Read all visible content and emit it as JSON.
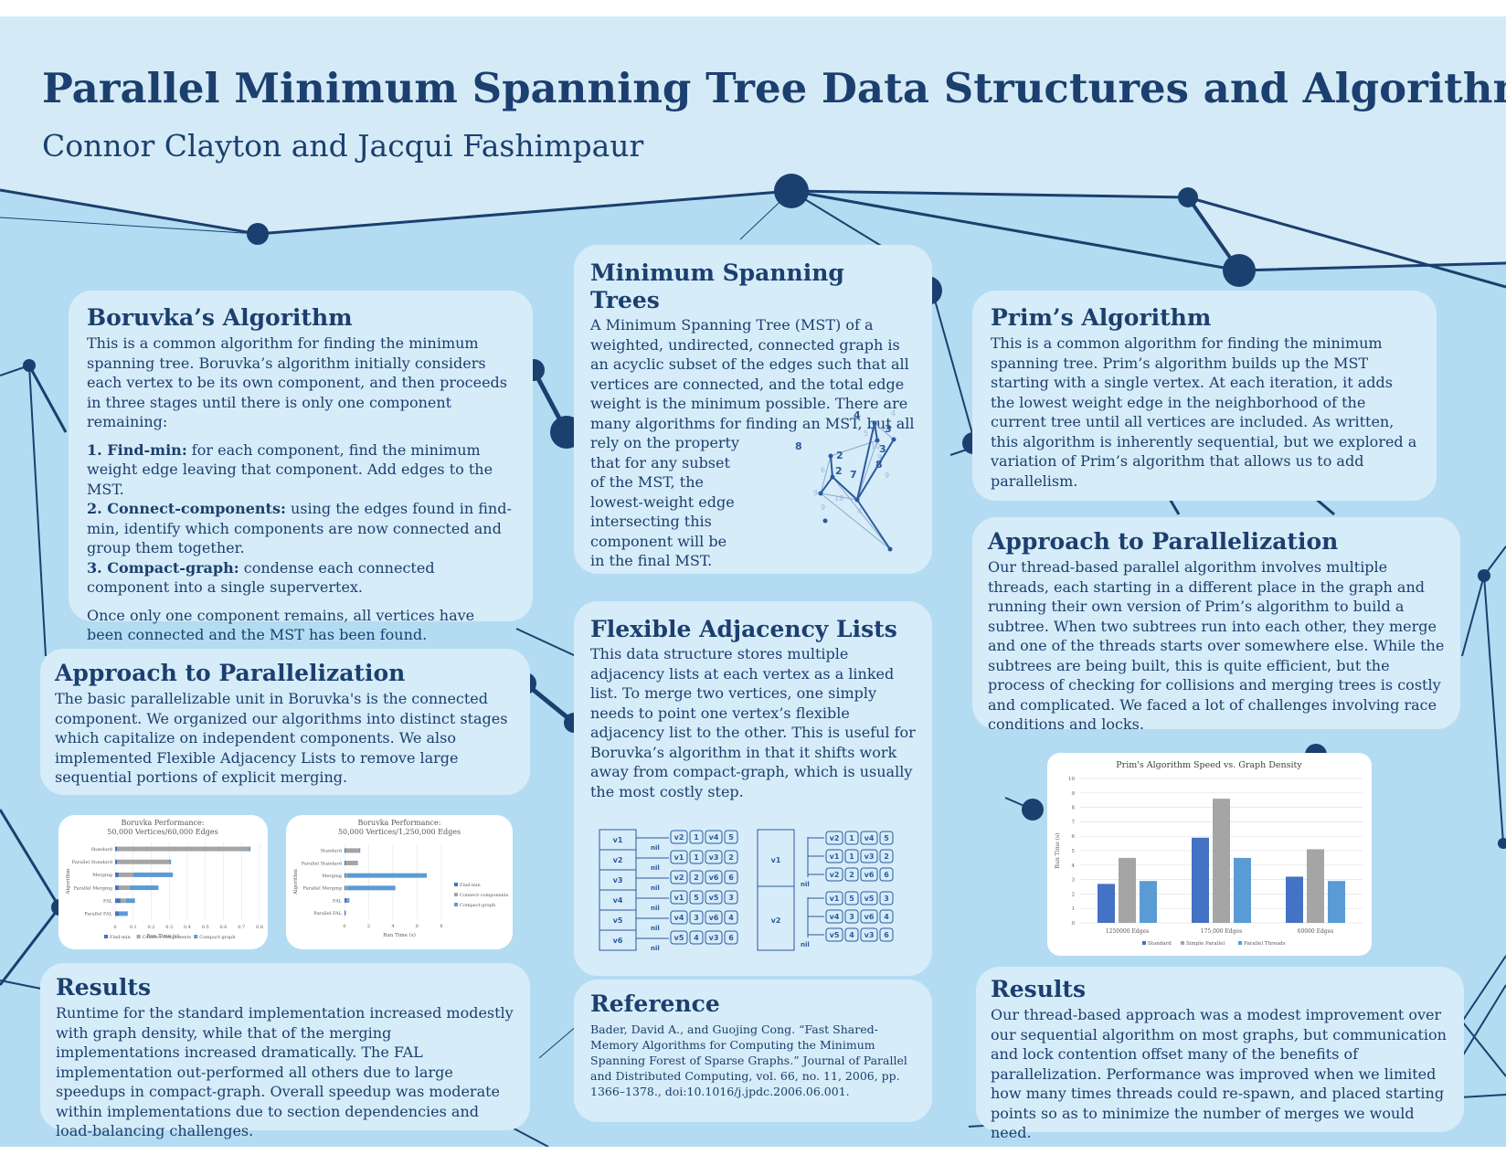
{
  "title": "Parallel Minimum Spanning Tree Data Structures and Algorithms",
  "authors": "Connor Clayton and Jacqui Fashimpaur",
  "boruvka": {
    "heading": "Boruvka’s Algorithm",
    "intro": "This is a common algorithm for finding the minimum spanning tree. Boruvka’s algorithm initially considers each vertex to be its own component, and then proceeds in three stages until there is only one component remaining:",
    "step1_label": "1. Find-min:",
    "step1_text": " for each component, find the minimum weight edge leaving that component. Add edges to the MST.",
    "step2_label": "2. Connect-components:",
    "step2_text": " using the edges found in find-min, identify which components are now connected and group them together.",
    "step3_label": "3. Compact-graph:",
    "step3_text": " condense each connected component into a single supervertex.",
    "outro": "Once only one component remains, all vertices have been connected and the MST has been found."
  },
  "boruvka_parallel": {
    "heading": "Approach to Parallelization",
    "text": "The basic parallelizable unit in Boruvka's is the connected component. We organized our algorithms into distinct stages which capitalize on independent components. We also implemented Flexible Adjacency Lists to remove large sequential portions of explicit merging."
  },
  "boruvka_results": {
    "heading": "Results",
    "text": "Runtime for the standard implementation increased modestly with graph density, while that of the merging implementations increased dramatically. The FAL implementation out-performed all others due to large speedups in compact-graph. Overall speedup was moderate within implementations due to section dependencies and load-balancing challenges."
  },
  "mst": {
    "heading": "Minimum Spanning Trees",
    "text_wide": "A Minimum Spanning Tree (MST) of a weighted, undirected, connected graph is an acyclic subset of the edges such that all vertices are connected, and the total edge weight is the minimum possible. There are many algorithms for finding an MST, but all",
    "text_narrow": "rely on the property that for any subset of the MST, the lowest-weight edge intersecting this component will be in the final MST."
  },
  "fal": {
    "heading": "Flexible Adjacency Lists",
    "text": "This data structure stores multiple adjacency lists at each vertex as a linked list. To merge two vertices, one simply needs to point one vertex’s flexible adjacency list to the other. This is useful for Boruvka’s algorithm in that it shifts work away from compact-graph, which is usually the most costly step."
  },
  "reference": {
    "heading": "Reference",
    "text": "Bader, David A., and Guojing Cong. “Fast Shared-Memory Algorithms for Computing the Minimum Spanning Forest of Sparse Graphs.” Journal of Parallel and Distributed Computing, vol. 66, no. 11, 2006, pp. 1366–1378., doi:10.1016/j.jpdc.2006.06.001."
  },
  "prim": {
    "heading": "Prim’s Algorithm",
    "text": "This is a common algorithm for finding the minimum spanning tree. Prim’s algorithm builds up the MST starting with a single vertex. At each iteration, it adds the lowest weight edge in the neighborhood of the current tree until all vertices are included. As written, this algorithm is inherently sequential, but we explored a variation of Prim’s algorithm that allows us to add parallelism."
  },
  "prim_parallel": {
    "heading": "Approach to Parallelization",
    "text": "Our thread-based parallel algorithm involves multiple threads, each starting in a different place in the graph and running their own version of Prim’s algorithm to build a subtree. When two subtrees run into each other, they merge and one of the threads starts over somewhere else. While the subtrees are being built, this is quite efficient, but the process of checking for collisions and merging trees is costly and complicated. We faced a lot of challenges involving race conditions and locks."
  },
  "prim_results": {
    "heading": "Results",
    "text": "Our thread-based approach was a modest improvement over our sequential algorithm on most graphs, but communication and lock contention offset many of the benefits of parallelization. Performance was improved when we limited how many times threads could re-spawn, and placed starting points so as to minimize the number of merges we would need."
  },
  "mst_graph": {
    "weights": [
      "4",
      "4",
      "3",
      "5",
      "2",
      "6",
      "2",
      "8",
      "7",
      "9",
      "10",
      "3",
      "9",
      "9",
      "8",
      "18",
      "9",
      "4"
    ]
  },
  "fal_diagram": {
    "left_vertices": [
      "v1",
      "v2",
      "v3",
      "v4",
      "v5",
      "v6"
    ],
    "right_vertices": [
      "v1",
      "v2"
    ],
    "nil": "nil",
    "lists": [
      [
        "v2",
        "1",
        "v4",
        "5"
      ],
      [
        "v1",
        "1",
        "v3",
        "2"
      ],
      [
        "v2",
        "2",
        "v6",
        "6"
      ],
      [
        "v1",
        "5",
        "v5",
        "3"
      ],
      [
        "v4",
        "3",
        "v6",
        "4"
      ],
      [
        "v5",
        "4",
        "v3",
        "6"
      ]
    ]
  },
  "chart_data": [
    {
      "type": "bar",
      "orientation": "horizontal",
      "stacked": true,
      "title": "Boruvka Performance:",
      "subtitle": "50,000 Vertices/60,000 Edges",
      "categories": [
        "Standard",
        "Parallel Standard",
        "Merging",
        "Parallel Merging",
        "FAL",
        "Parallel FAL"
      ],
      "series": [
        {
          "name": "Find-min",
          "values": [
            0.01,
            0.01,
            0.02,
            0.02,
            0.03,
            0.02
          ]
        },
        {
          "name": "Connect-components",
          "values": [
            0.73,
            0.29,
            0.08,
            0.06,
            0.03,
            0.0
          ]
        },
        {
          "name": "Compact-graph",
          "values": [
            0.01,
            0.01,
            0.22,
            0.16,
            0.05,
            0.05
          ]
        }
      ],
      "xlabel": "Run Time (s)",
      "ylabel": "Algorithm",
      "xticks": [
        "0",
        "0.1",
        "0.2",
        "0.3",
        "0.4",
        "0.5",
        "0.6",
        "0.7",
        "0.8"
      ],
      "xlim": [
        0,
        0.8
      ],
      "legend": "bottom",
      "colors": {
        "Find-min": "#4472c4",
        "Connect-components": "#a5a5a5",
        "Compact-graph": "#5b9bd5"
      }
    },
    {
      "type": "bar",
      "orientation": "horizontal",
      "stacked": true,
      "title": "Boruvka Performance:",
      "subtitle": "50,000 Vertices/1,250,000 Edges",
      "categories": [
        "Standard",
        "Parallel Standard",
        "Merging",
        "Parallel Merging",
        "FAL",
        "Parallel FAL"
      ],
      "series": [
        {
          "name": "Find-min",
          "values": [
            0.1,
            0.1,
            0.1,
            0.1,
            0.2,
            0.1
          ]
        },
        {
          "name": "Connect-components",
          "values": [
            1.1,
            0.9,
            0.1,
            0.1,
            0.1,
            0.0
          ]
        },
        {
          "name": "Compact-graph",
          "values": [
            0.1,
            0.1,
            6.6,
            4.0,
            0.1,
            0.0
          ]
        }
      ],
      "xlabel": "Run Time (s)",
      "ylabel": "Algorithm",
      "xticks": [
        "0",
        "2",
        "4",
        "6",
        "8"
      ],
      "xlim": [
        0,
        8
      ],
      "legend": "right",
      "colors": {
        "Find-min": "#4472c4",
        "Connect-components": "#a5a5a5",
        "Compact-graph": "#5b9bd5"
      }
    },
    {
      "type": "bar",
      "orientation": "vertical",
      "title": "Prim's Algorithm Speed vs. Graph Density",
      "categories": [
        "1250000 Edges",
        "175,000 Edges",
        "60000 Edges"
      ],
      "series": [
        {
          "name": "Standard",
          "values": [
            2.7,
            5.9,
            3.2
          ]
        },
        {
          "name": "Simple Parallel",
          "values": [
            4.5,
            8.6,
            5.1
          ]
        },
        {
          "name": "Parallel Threads",
          "values": [
            2.9,
            4.5,
            2.9
          ]
        }
      ],
      "ylabel": "Run Time (s)",
      "yticks": [
        "0",
        "1",
        "2",
        "3",
        "4",
        "5",
        "6",
        "7",
        "8",
        "9",
        "10"
      ],
      "ylim": [
        0,
        10
      ],
      "grid": true,
      "legend": "bottom",
      "colors": {
        "Standard": "#4472c4",
        "Simple Parallel": "#a5a5a5",
        "Parallel Threads": "#5b9bd5"
      }
    }
  ]
}
